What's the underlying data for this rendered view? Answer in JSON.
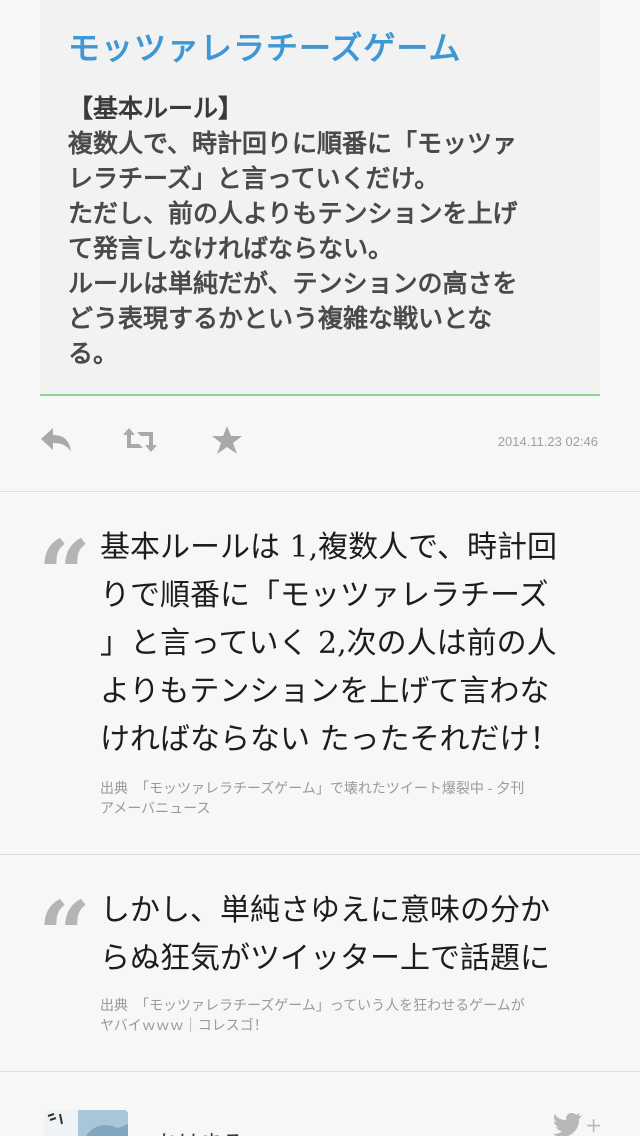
{
  "image_card": {
    "title": "モッツァレラチーズゲーム",
    "rule_heading": "【基本ルール】",
    "lines": [
      "複数人で、時計回りに順番に「モッツァ",
      "レラチーズ」と言っていくだけ。",
      "ただし、前の人よりもテンションを上げ",
      "て発言しなければならない。",
      "ルールは単純だが、テンションの高さを",
      "どう表現するかという複雑な戦いとな",
      "る。"
    ]
  },
  "actions": {
    "reply_icon": "reply-icon",
    "retweet_icon": "retweet-icon",
    "favorite_icon": "star-icon",
    "timestamp": "2014.11.23 02:46"
  },
  "quotes": [
    {
      "mark": "“",
      "lines": [
        "基本ルールは 1,複数人で、時計回",
        "りで順番に「モッツァレラチーズ",
        "」と言っていく 2,次の人は前の人",
        "よりもテンションを上げて言わな",
        "ければならない たったそれだけ！"
      ],
      "source_lines": [
        "出典　「モッツァレラチーズゲーム」で壊れたツイート爆裂中 - 夕刊",
        "アメーバニュース"
      ]
    },
    {
      "mark": "“",
      "lines": [
        "しかし、単純さゆえに意味の分か",
        "らぬ狂気がツイッター上で話題に"
      ],
      "source_lines": [
        "出典　「モッツァレラチーズゲーム」っていう人を狂わせるゲームが",
        "ヤバイｗｗｗ｜コレスゴ！"
      ]
    }
  ],
  "footer": {
    "avatar_icon": "avatar",
    "name": "ちはまる",
    "follow_icon": "twitter-bird-icon",
    "follow_plus": "+"
  },
  "colors": {
    "title_blue": "#3f98d4",
    "accent_green": "#8dd696",
    "icon_gray": "#a9a9a9",
    "twitter_gray": "#b8b8b8"
  }
}
